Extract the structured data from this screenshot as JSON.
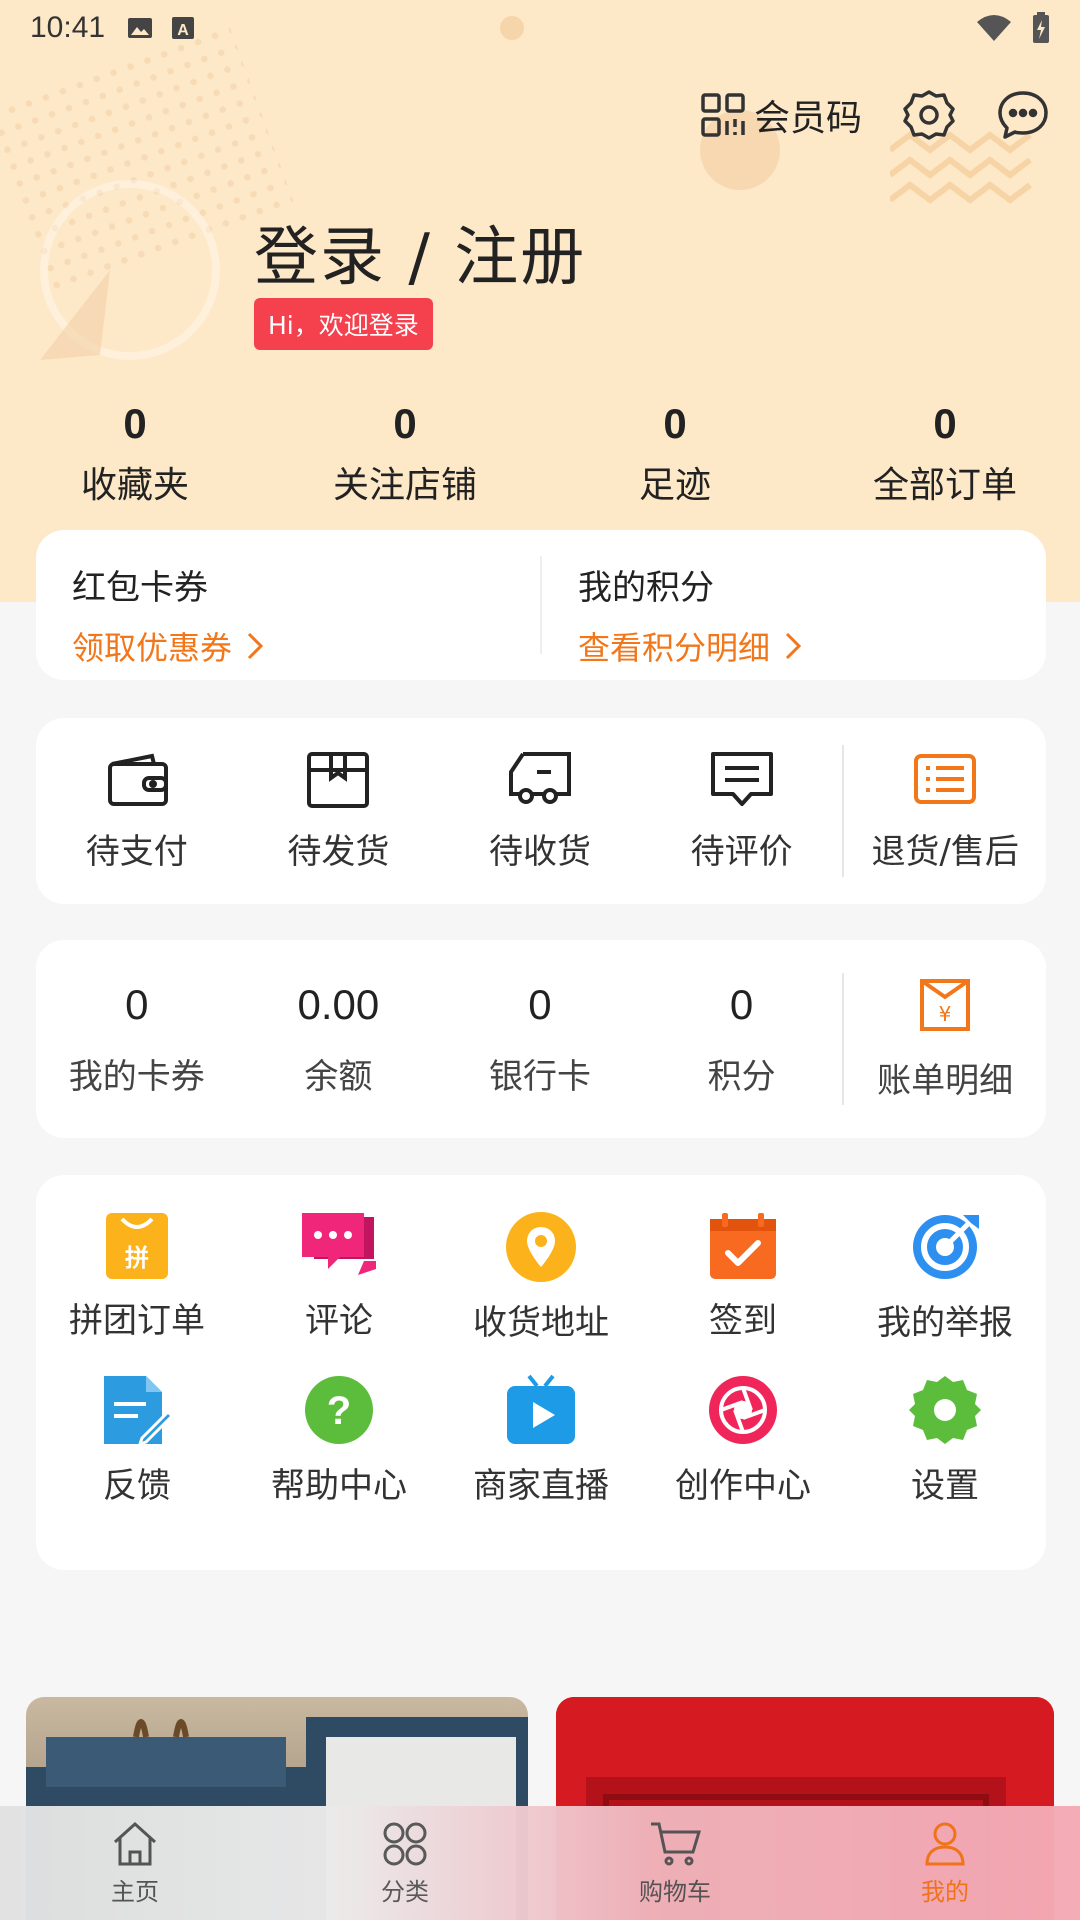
{
  "status_bar": {
    "time": "10:41"
  },
  "header": {
    "member_code_label": "会员码",
    "login_title": "登录 / 注册",
    "welcome_badge": "Hi，欢迎登录"
  },
  "stats": [
    {
      "value": "0",
      "label": "收藏夹"
    },
    {
      "value": "0",
      "label": "关注店铺"
    },
    {
      "value": "0",
      "label": "足迹"
    },
    {
      "value": "0",
      "label": "全部订单"
    }
  ],
  "coupons": {
    "red_packet_title": "红包卡券",
    "red_packet_link": "领取优惠券",
    "points_title": "我的积分",
    "points_link": "查看积分明细"
  },
  "orders": [
    {
      "label": "待支付",
      "icon": "wallet-icon"
    },
    {
      "label": "待发货",
      "icon": "package-icon"
    },
    {
      "label": "待收货",
      "icon": "truck-icon"
    },
    {
      "label": "待评价",
      "icon": "comment-icon"
    },
    {
      "label": "退货/售后",
      "icon": "list-icon"
    }
  ],
  "wallet": [
    {
      "value": "0",
      "label": "我的卡券"
    },
    {
      "value": "0.00",
      "label": "余额"
    },
    {
      "value": "0",
      "label": "银行卡"
    },
    {
      "value": "0",
      "label": "积分"
    }
  ],
  "bill_label": "账单明细",
  "tools": [
    {
      "label": "拼团订单",
      "icon": "group-buy-icon",
      "color": "#fbb21b",
      "glyph": "拼"
    },
    {
      "label": "评论",
      "icon": "chat-bubbles-icon",
      "color": "#f0267a"
    },
    {
      "label": "收货地址",
      "icon": "location-icon",
      "color": "#fbb21b"
    },
    {
      "label": "签到",
      "icon": "calendar-check-icon",
      "color": "#f76a1f"
    },
    {
      "label": "我的举报",
      "icon": "target-icon",
      "color": "#2d8ff0"
    },
    {
      "label": "反馈",
      "icon": "document-edit-icon",
      "color": "#2d9be0"
    },
    {
      "label": "帮助中心",
      "icon": "help-icon",
      "color": "#5bbd3b"
    },
    {
      "label": "商家直播",
      "icon": "tv-play-icon",
      "color": "#1e9be6"
    },
    {
      "label": "创作中心",
      "icon": "aperture-icon",
      "color": "#f0265a"
    },
    {
      "label": "设置",
      "icon": "gear-icon",
      "color": "#5bbd3b"
    }
  ],
  "tabs": [
    {
      "label": "主页",
      "icon": "home-icon"
    },
    {
      "label": "分类",
      "icon": "category-icon"
    },
    {
      "label": "购物车",
      "icon": "cart-icon"
    },
    {
      "label": "我的",
      "icon": "user-icon",
      "active": true
    }
  ],
  "colors": {
    "accent": "#f2771b",
    "header_bg": "#fde8c8",
    "badge": "#f5414d"
  }
}
